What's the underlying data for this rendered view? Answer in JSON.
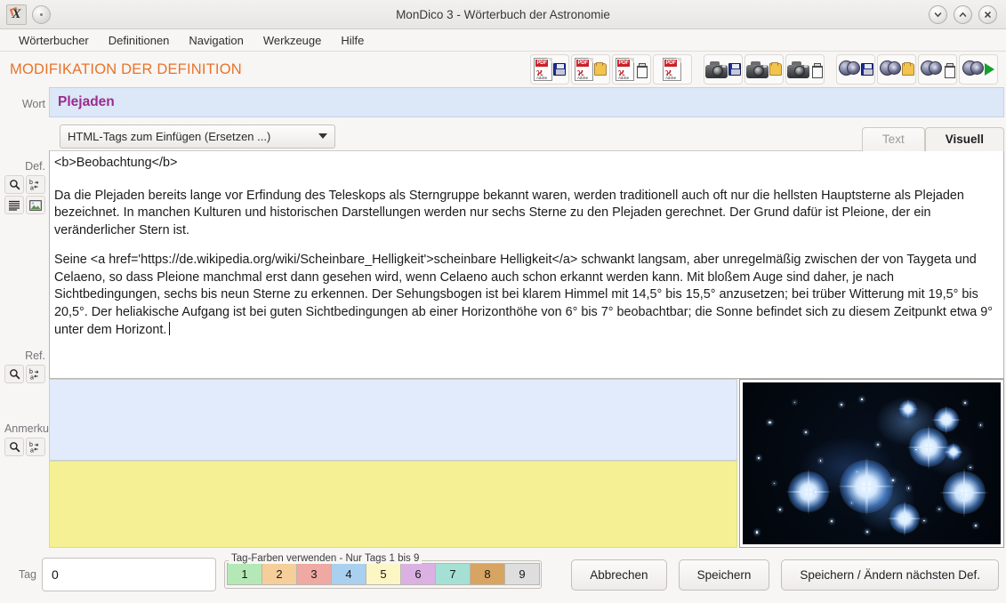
{
  "window": {
    "title": "MonDico 3 - Wörterbuch der Astronomie",
    "app_icon": "x-logo-icon",
    "controls": {
      "minimize": "chevron-down-icon",
      "maximize": "chevron-up-icon",
      "close": "close-icon"
    }
  },
  "menubar": {
    "items": [
      {
        "label": "Wörterbucher"
      },
      {
        "label": "Definitionen"
      },
      {
        "label": "Navigation"
      },
      {
        "label": "Werkzeuge"
      },
      {
        "label": "Hilfe"
      }
    ]
  },
  "header": {
    "page_title": "MODIFIKATION DER DEFINITION",
    "title_color": "#e8732a"
  },
  "toolbar": {
    "groups": [
      {
        "name": "pdf",
        "buttons": [
          {
            "name": "pdf-save-button",
            "glyph": "pdf-icon",
            "badge": "save-icon"
          },
          {
            "name": "pdf-open-button",
            "glyph": "pdf-icon",
            "badge": "open-folder-icon"
          },
          {
            "name": "pdf-delete-button",
            "glyph": "pdf-icon",
            "badge": "trash-icon"
          },
          {
            "name": "pdf-button",
            "glyph": "pdf-icon",
            "badge": "none"
          }
        ]
      },
      {
        "name": "photo",
        "buttons": [
          {
            "name": "photo-save-button",
            "glyph": "camera-icon",
            "badge": "save-icon"
          },
          {
            "name": "photo-open-button",
            "glyph": "camera-icon",
            "badge": "open-folder-icon"
          },
          {
            "name": "photo-delete-button",
            "glyph": "camera-icon",
            "badge": "trash-icon"
          }
        ]
      },
      {
        "name": "video",
        "buttons": [
          {
            "name": "video-save-button",
            "glyph": "film-reel-icon",
            "badge": "save-icon"
          },
          {
            "name": "video-open-button",
            "glyph": "film-reel-icon",
            "badge": "open-folder-icon"
          },
          {
            "name": "video-delete-button",
            "glyph": "film-reel-icon",
            "badge": "trash-icon"
          },
          {
            "name": "video-play-button",
            "glyph": "film-reel-icon",
            "badge": "play-icon"
          }
        ]
      }
    ]
  },
  "form": {
    "word_label": "Wort",
    "word_value": "Plejaden",
    "word_color": "#9c2b8e",
    "html_tags_select": "HTML-Tags zum Einfügen (Ersetzen ...)",
    "tabs": [
      {
        "label": "Text",
        "active": false
      },
      {
        "label": "Visuell",
        "active": true
      }
    ],
    "def_label": "Def.",
    "ref_label": "Ref.",
    "anmerk_label": "Anmerku",
    "tag_label": "Tag",
    "tag_value": "0"
  },
  "definition": {
    "heading_markup": "<b>Beobachtung</b>",
    "paragraph_1": "Da die Plejaden bereits lange vor Erfindung des Teleskops als Sterngruppe bekannt waren, werden traditionell auch oft nur die hellsten Hauptsterne als Plejaden bezeichnet. In manchen Kulturen und historischen Darstellungen werden nur sechs Sterne zu den Plejaden gerechnet. Der Grund dafür ist Pleione, der ein veränderlicher Stern ist.",
    "paragraph_2": "Seine <a href='https://de.wikipedia.org/wiki/Scheinbare_Helligkeit'>scheinbare Helligkeit</a> schwankt langsam, aber unregelmäßig zwischen der von Taygeta und Celaeno, so dass Pleione manchmal erst dann gesehen wird, wenn Celaeno auch schon erkannt werden kann. Mit bloßem Auge sind daher, je nach Sichtbedingungen, sechs bis neun Sterne zu erkennen. Der Sehungsbogen ist bei klarem Himmel mit 14,5° bis 15,5° anzusetzen; bei trüber Witterung mit 19,5° bis 20,5°. Der heliakische Aufgang ist bei guten Sichtbedingungen ab einer Horizonthöhe von 6° bis 7° beobachtbar; die Sonne befindet sich zu diesem Zeitpunkt etwa 9° unter dem Horizont."
  },
  "gutter_icons": {
    "def": [
      {
        "name": "search-icon"
      },
      {
        "name": "replace-icon"
      },
      {
        "name": "list-lines-icon"
      },
      {
        "name": "image-icon"
      }
    ],
    "ref": [
      {
        "name": "search-icon"
      },
      {
        "name": "replace-icon"
      }
    ],
    "anmerk": [
      {
        "name": "search-icon"
      },
      {
        "name": "replace-icon"
      }
    ]
  },
  "panels": {
    "ref_bg": "#e2ebfb",
    "anmerk_bg": "#f5f093",
    "image_alt": "Plejaden-Sternhaufen"
  },
  "tagcolors": {
    "legend": "Tag-Farben verwenden - Nur Tags 1 bis 9",
    "items": [
      {
        "label": "1",
        "color": "#b5e8b7"
      },
      {
        "label": "2",
        "color": "#f6ce9a"
      },
      {
        "label": "3",
        "color": "#efa8a2"
      },
      {
        "label": "4",
        "color": "#a9d0ef"
      },
      {
        "label": "5",
        "color": "#fbf6c4"
      },
      {
        "label": "6",
        "color": "#dbb1e3"
      },
      {
        "label": "7",
        "color": "#a5e0d4"
      },
      {
        "label": "8",
        "color": "#d8a462"
      },
      {
        "label": "9",
        "color": "#dedede"
      }
    ]
  },
  "buttons": {
    "cancel": "Abbrechen",
    "save": "Speichern",
    "save_next": "Speichern / Ändern nächsten Def."
  }
}
